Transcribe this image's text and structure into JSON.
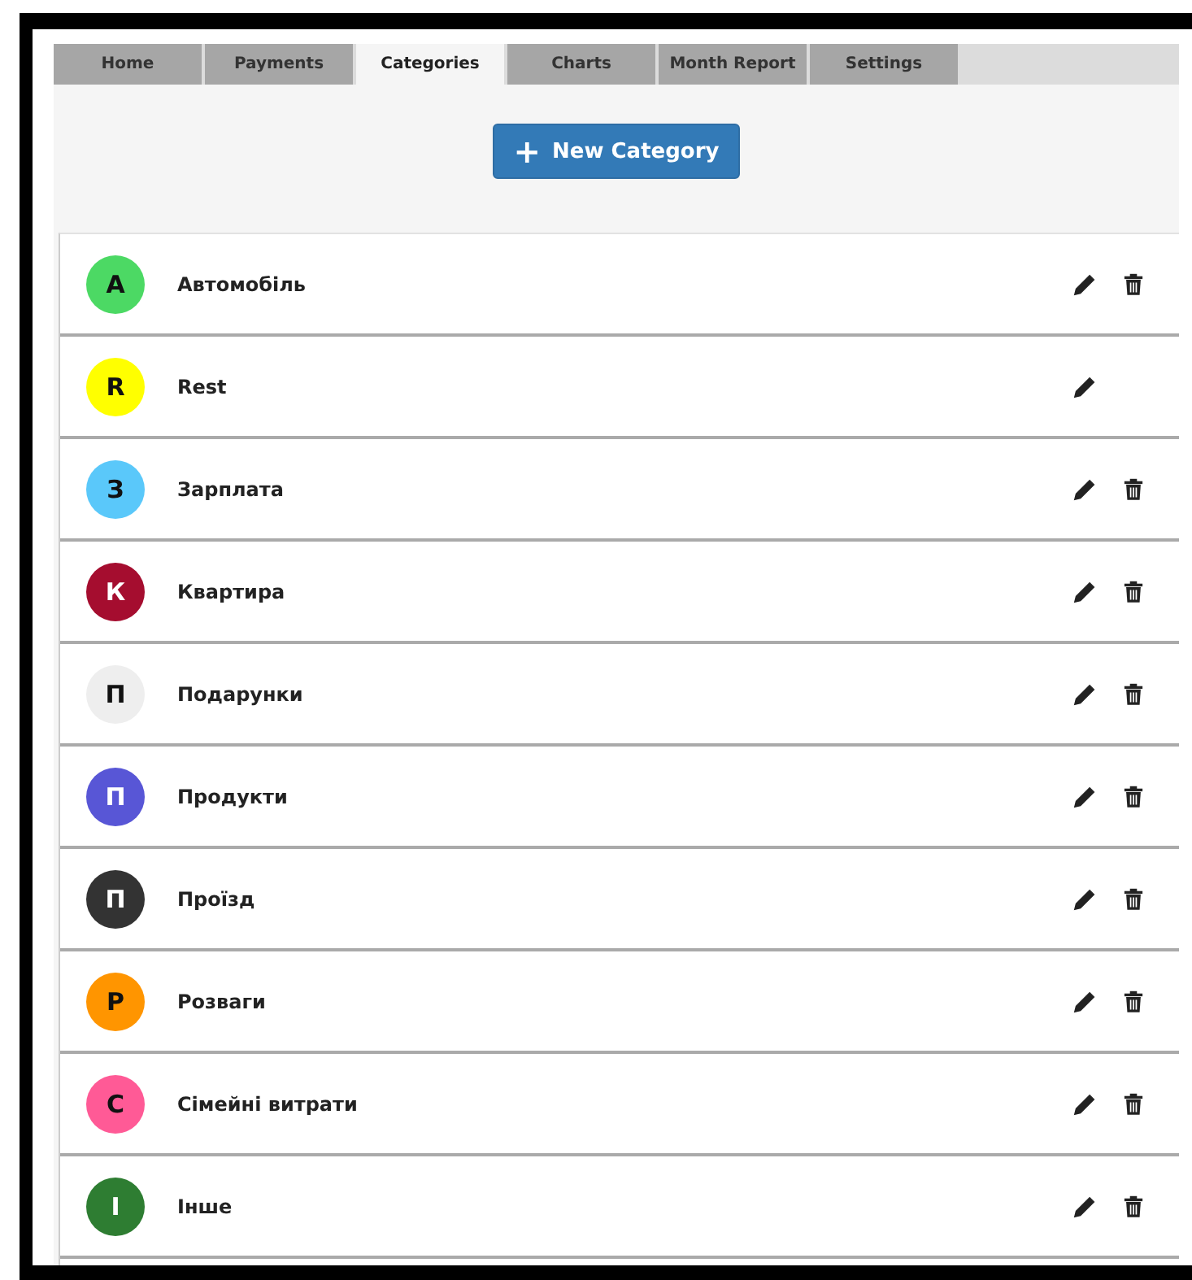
{
  "tabs": [
    {
      "label": "Home",
      "selected": false
    },
    {
      "label": "Payments",
      "selected": false
    },
    {
      "label": "Categories",
      "selected": true
    },
    {
      "label": "Charts",
      "selected": false
    },
    {
      "label": "Month Report",
      "selected": false
    },
    {
      "label": "Settings",
      "selected": false
    }
  ],
  "new_button": {
    "icon": "+",
    "label": "New Category"
  },
  "categories": [
    {
      "initial": "А",
      "name": "Автомобіль",
      "color": "#4cd964",
      "deletable": true
    },
    {
      "initial": "R",
      "name": "Rest",
      "color": "#ffff00",
      "deletable": false
    },
    {
      "initial": "З",
      "name": "Зарплата",
      "color": "#5ac8fa",
      "deletable": true
    },
    {
      "initial": "К",
      "name": "Квартира",
      "color": "#a50d2f",
      "deletable": true
    },
    {
      "initial": "П",
      "name": "Подарунки",
      "color": "#eeeeee",
      "deletable": true
    },
    {
      "initial": "П",
      "name": "Продукти",
      "color": "#5856d6",
      "deletable": true
    },
    {
      "initial": "П",
      "name": "Проїзд",
      "color": "#333333",
      "deletable": true
    },
    {
      "initial": "Р",
      "name": "Розваги",
      "color": "#ff9500",
      "deletable": true
    },
    {
      "initial": "С",
      "name": "Сімейні витрати",
      "color": "#ff5a96",
      "deletable": true
    },
    {
      "initial": "І",
      "name": "Інше",
      "color": "#2e7d32",
      "deletable": true
    }
  ]
}
